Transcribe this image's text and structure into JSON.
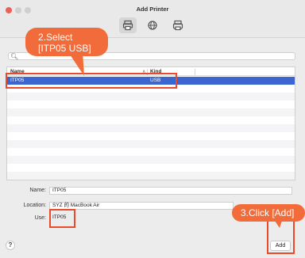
{
  "window": {
    "title": "Add Printer",
    "toolbar": [
      "printer-default-icon",
      "globe-ip-icon",
      "windows-printer-icon"
    ]
  },
  "search": {
    "placeholder": ""
  },
  "table": {
    "columns": [
      "Name",
      "Kind"
    ],
    "rows": [
      {
        "name": "ITP05",
        "kind": "USB",
        "selected": true
      }
    ]
  },
  "form": {
    "name_label": "Name:",
    "name_value": "ITP05",
    "location_label": "Location:",
    "location_value": "SYZ 的 MacBook Air",
    "use_label": "Use:",
    "use_value": "ITP05"
  },
  "buttons": {
    "help": "?",
    "add": "Add"
  },
  "annotations": {
    "step2_line1": "2.Select",
    "step2_line2": "[ITP05 USB]",
    "step3": "3.Click [Add]"
  },
  "colors": {
    "accent": "#f26b3a",
    "highlight": "#ea4a2a",
    "selection": "#3b66d0"
  }
}
